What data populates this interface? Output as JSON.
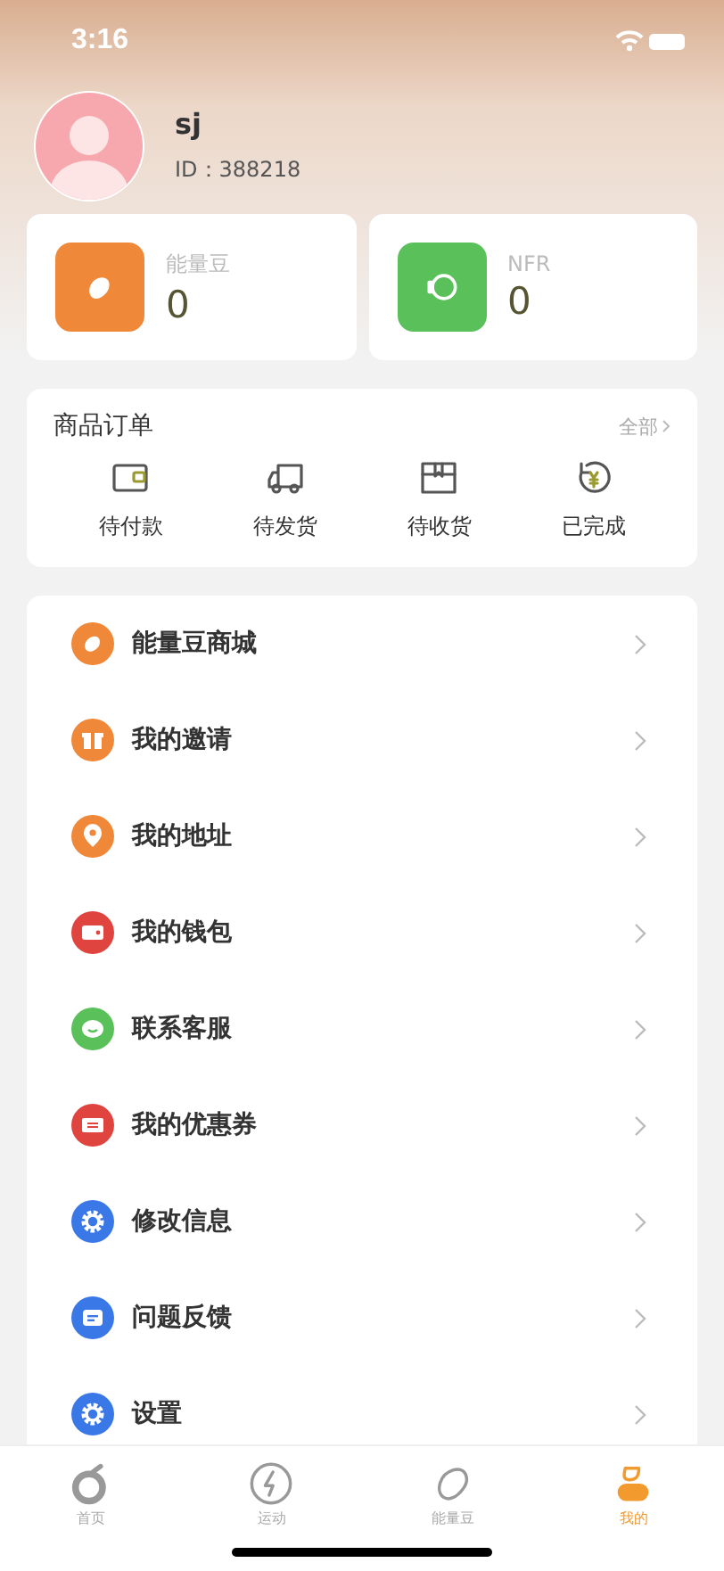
{
  "status_bar": {
    "time": "3:16"
  },
  "profile": {
    "name": "sj",
    "id": "ID：388218"
  },
  "wallets": [
    {
      "kind": "bean",
      "label": "能量豆",
      "value": "0",
      "color": "#f0883a"
    },
    {
      "kind": "watch",
      "label": "NFR",
      "value": "0",
      "color": "#5ac05a"
    }
  ],
  "orders": {
    "title": "商品订单",
    "all_link": "全部",
    "items": [
      {
        "kind": "wallet",
        "label": "待付款"
      },
      {
        "kind": "truck",
        "label": "待发货"
      },
      {
        "kind": "box",
        "label": "待收货"
      },
      {
        "kind": "yen",
        "label": "已完成"
      }
    ]
  },
  "menu": [
    {
      "kind": "bean",
      "label": "能量豆商城",
      "color": "#f0883a"
    },
    {
      "kind": "gift",
      "label": "我的邀请",
      "color": "#f0883a"
    },
    {
      "kind": "pin",
      "label": "我的地址",
      "color": "#f0883a"
    },
    {
      "kind": "wallet",
      "label": "我的钱包",
      "color": "#e0443e"
    },
    {
      "kind": "chat",
      "label": "联系客服",
      "color": "#5ac05a"
    },
    {
      "kind": "ticket",
      "label": "我的优惠券",
      "color": "#e0443e"
    },
    {
      "kind": "gear",
      "label": "修改信息",
      "color": "#3b78e7"
    },
    {
      "kind": "note",
      "label": "问题反馈",
      "color": "#3b78e7"
    },
    {
      "kind": "gear",
      "label": "设置",
      "color": "#3b78e7"
    }
  ],
  "tab_bar": [
    {
      "kind": "fruit",
      "label": "首页",
      "selected": false
    },
    {
      "kind": "bolt",
      "label": "运动",
      "selected": false
    },
    {
      "kind": "bean",
      "label": "能量豆",
      "selected": false
    },
    {
      "kind": "person",
      "label": "我的",
      "selected": true
    }
  ]
}
